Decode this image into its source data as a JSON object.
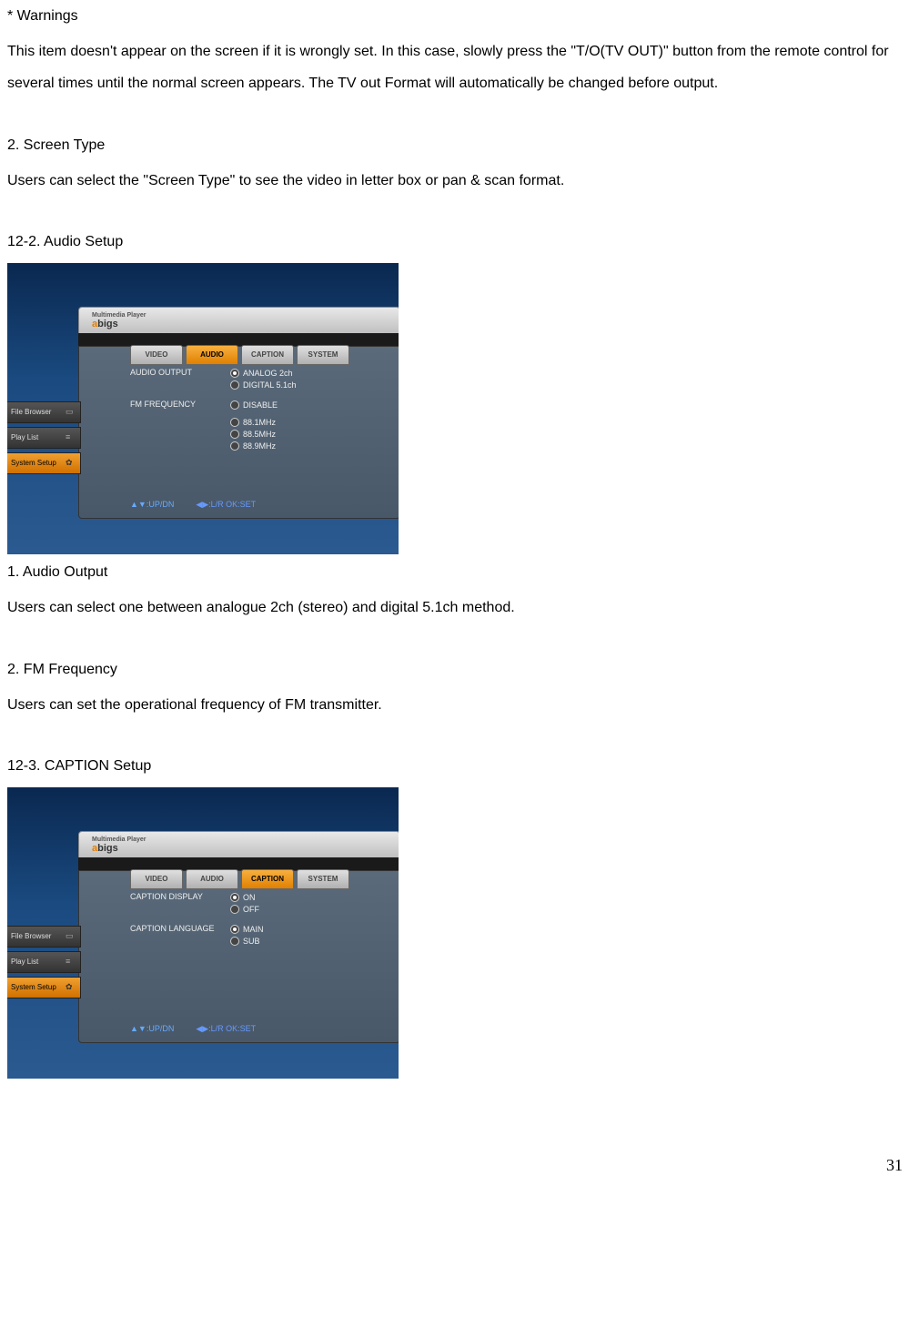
{
  "text": {
    "warnings_heading": "* Warnings",
    "warnings_body": "This item doesn't appear on the screen if it is wrongly set. In this case, slowly press the \"T/O(TV OUT)\" button from the remote control for several times until the normal screen appears. The TV out Format will automatically be changed before output.",
    "screen_type_heading": "2. Screen Type",
    "screen_type_body": "Users can select the \"Screen Type\" to see the video in letter box or pan & scan format.",
    "audio_setup_heading": "12-2. Audio Setup",
    "audio_output_heading": "1. Audio Output",
    "audio_output_body": "Users can select one between analogue 2ch (stereo) and digital 5.1ch method.",
    "fm_heading": "2. FM Frequency",
    "fm_body": "Users can set the operational frequency of FM transmitter.",
    "caption_setup_heading": "12-3. CAPTION Setup",
    "page_number": "31"
  },
  "device_common": {
    "brand_prefix": "a",
    "brand_suffix": "bigs",
    "brand_tag": "Multimedia Player",
    "side": {
      "file_browser": "File Browser",
      "play_list": "Play List",
      "system_setup": "System Setup"
    },
    "tabs": {
      "video": "VIDEO",
      "audio": "AUDIO",
      "caption": "CAPTION",
      "system": "SYSTEM"
    },
    "hints": {
      "updn": "▲▼:UP/DN",
      "lr_ok": "◀▶:L/R  OK:SET"
    }
  },
  "audio_screen": {
    "labels": {
      "audio_output": "AUDIO OUTPUT",
      "fm_frequency": "FM FREQUENCY"
    },
    "options": {
      "analog": "ANALOG 2ch",
      "digital": "DIGITAL 5.1ch",
      "disable": "DISABLE",
      "f881": "88.1MHz",
      "f885": "88.5MHz",
      "f889": "88.9MHz"
    }
  },
  "caption_screen": {
    "labels": {
      "caption_display": "CAPTION DISPLAY",
      "caption_language": "CAPTION LANGUAGE"
    },
    "options": {
      "on": "ON",
      "off": "OFF",
      "main": "MAIN",
      "sub": "SUB"
    }
  }
}
